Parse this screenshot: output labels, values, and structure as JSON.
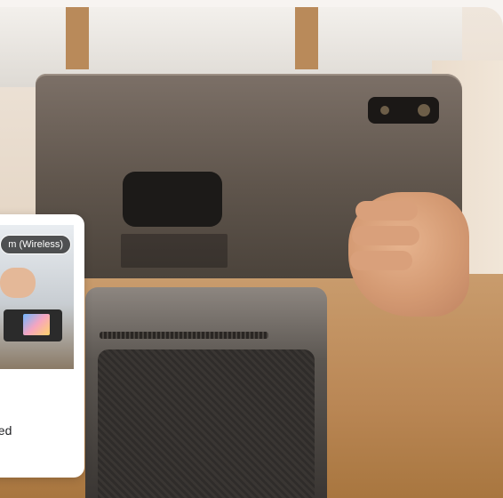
{
  "card": {
    "chip_label": "m (Wireless)",
    "body_text": "eed"
  },
  "colors": {
    "card_bg": "#ffffff",
    "chip_bg": "#000000",
    "page_bg": "#f7f4f1"
  },
  "icons": {
    "camera": "camera-module-icon",
    "dock": "dock-connector-icon"
  }
}
